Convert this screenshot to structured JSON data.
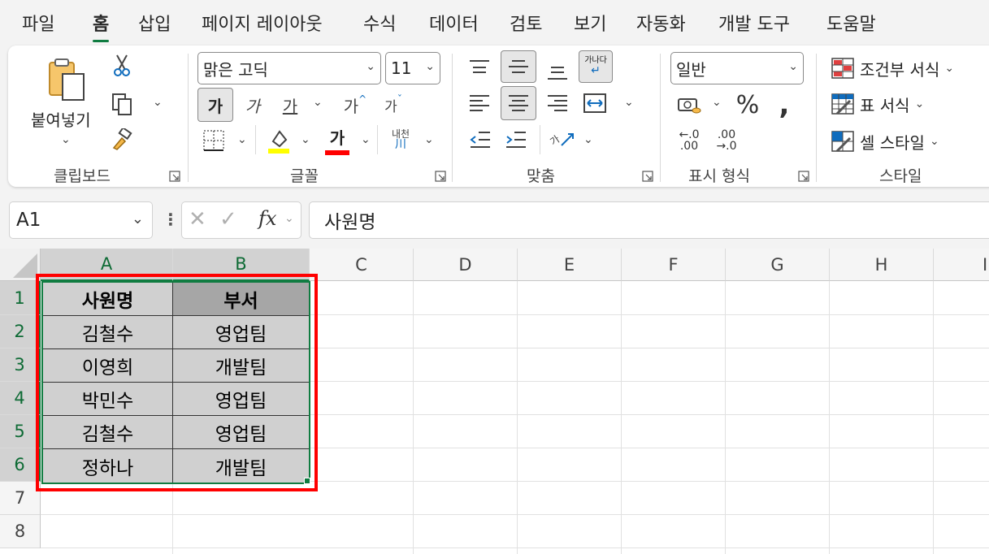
{
  "menu": {
    "tabs": [
      "파일",
      "홈",
      "삽입",
      "페이지 레이아웃",
      "수식",
      "데이터",
      "검토",
      "보기",
      "자동화",
      "개발 도구",
      "도움말"
    ],
    "active": "홈"
  },
  "ribbon": {
    "clipboard": {
      "paste_label": "붙여넣기",
      "group_label": "클립보드"
    },
    "font": {
      "font_name": "맑은 고딕",
      "font_size": "11",
      "bold_glyph": "가",
      "italic_glyph": "가",
      "underline_glyph": "가",
      "grow_glyph": "가",
      "shrink_glyph": "가",
      "font_color_glyph": "가",
      "phonetic_glyph": "내천",
      "phonetic_sub": "川",
      "group_label": "글꼴",
      "highlight_color": "#ffff00",
      "font_color": "#ff0000"
    },
    "alignment": {
      "wrap_glyph": "가나다",
      "orient_glyph": "가",
      "group_label": "맞춤"
    },
    "number": {
      "format": "일반",
      "group_label": "표시 형식"
    },
    "styles": {
      "conditional": "조건부 서식",
      "table": "표 서식",
      "cell": "셀 스타일",
      "group_label": "스타일"
    }
  },
  "formula_bar": {
    "name_box": "A1",
    "fx": "fx",
    "content": "사원명"
  },
  "sheet": {
    "columns": [
      "A",
      "B",
      "C",
      "D",
      "E",
      "F",
      "G",
      "H",
      "I"
    ],
    "rows": [
      "1",
      "2",
      "3",
      "4",
      "5",
      "6",
      "7",
      "8"
    ],
    "table": {
      "headers": [
        "사원명",
        "부서"
      ],
      "rows": [
        [
          "김철수",
          "영업팀"
        ],
        [
          "이영희",
          "개발팀"
        ],
        [
          "박민수",
          "영업팀"
        ],
        [
          "김철수",
          "영업팀"
        ],
        [
          "정하나",
          "개발팀"
        ]
      ]
    },
    "accent": "#107c41",
    "highlight_border": "#ff0000"
  }
}
